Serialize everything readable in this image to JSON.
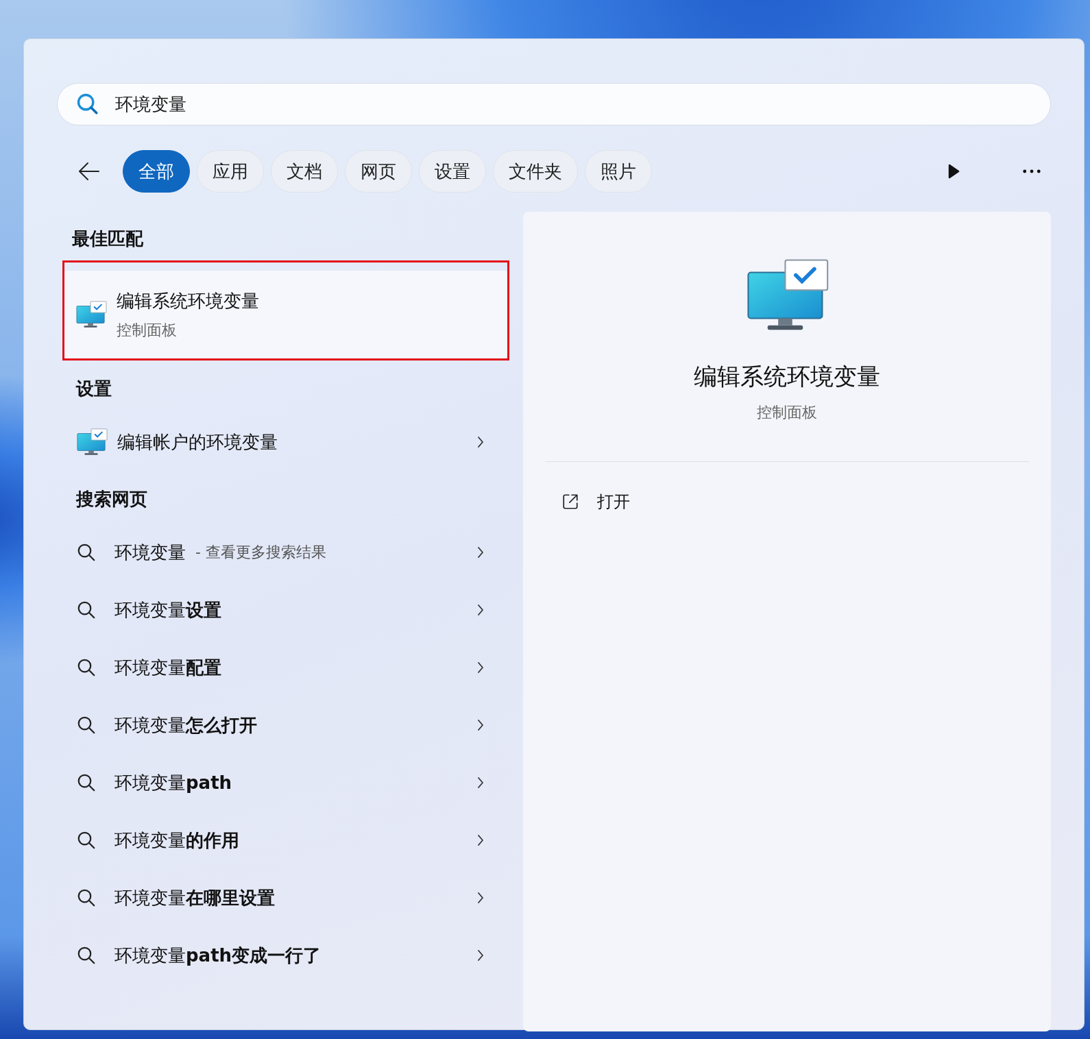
{
  "search": {
    "value": "环境变量"
  },
  "filters": [
    {
      "label": "全部",
      "selected": true
    },
    {
      "label": "应用",
      "selected": false
    },
    {
      "label": "文档",
      "selected": false
    },
    {
      "label": "网页",
      "selected": false
    },
    {
      "label": "设置",
      "selected": false
    },
    {
      "label": "文件夹",
      "selected": false
    },
    {
      "label": "照片",
      "selected": false
    }
  ],
  "best_match": {
    "heading": "最佳匹配",
    "title": "编辑系统环境变量",
    "subtitle": "控制面板",
    "highlighted": true
  },
  "settings": {
    "heading": "设置",
    "items": [
      {
        "label": "编辑帐户的环境变量"
      }
    ]
  },
  "web": {
    "heading": "搜索网页",
    "items": [
      {
        "text": "环境变量",
        "hint": "- 查看更多搜索结果"
      },
      {
        "text": "环境变量**设置**"
      },
      {
        "text": "环境变量**配置**"
      },
      {
        "text": "环境变量**怎么打开**"
      },
      {
        "text": "环境变量**path**"
      },
      {
        "text": "环境变量**的作用**"
      },
      {
        "text": "环境变量**在哪里设置**"
      },
      {
        "text": "环境变量**path变成一行了**"
      }
    ]
  },
  "preview": {
    "title": "编辑系统环境变量",
    "subtitle": "控制面板",
    "actions": [
      {
        "label": "打开"
      }
    ]
  }
}
